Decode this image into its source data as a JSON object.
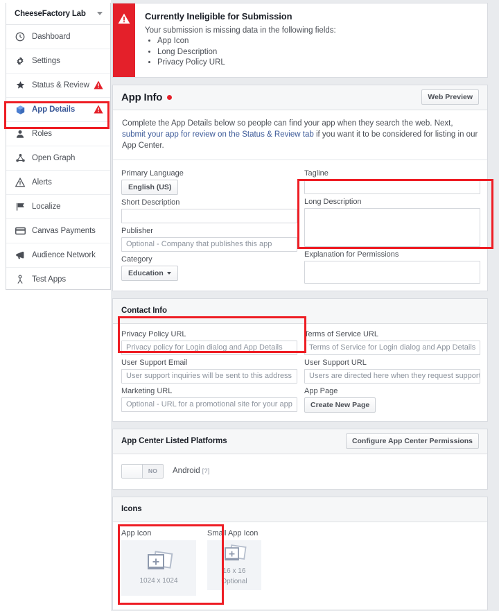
{
  "sidebar": {
    "header": {
      "title": "CheeseFactory Lab",
      "caret": "chevron-down-icon"
    },
    "items": [
      {
        "label": "Dashboard",
        "icon": "clock-icon",
        "warn": false,
        "active": false
      },
      {
        "label": "Settings",
        "icon": "gear-icon",
        "warn": false,
        "active": false
      },
      {
        "label": "Status & Review",
        "icon": "star-icon",
        "warn": true,
        "active": false
      },
      {
        "label": "App Details",
        "icon": "box-icon",
        "warn": true,
        "active": true
      },
      {
        "label": "Roles",
        "icon": "person-icon",
        "warn": false,
        "active": false
      },
      {
        "label": "Open Graph",
        "icon": "graph-icon",
        "warn": false,
        "active": false
      },
      {
        "label": "Alerts",
        "icon": "warning-icon",
        "warn": false,
        "active": false
      },
      {
        "label": "Localize",
        "icon": "flag-icon",
        "warn": false,
        "active": false
      },
      {
        "label": "Canvas Payments",
        "icon": "card-icon",
        "warn": false,
        "active": false
      },
      {
        "label": "Audience Network",
        "icon": "megaphone-icon",
        "warn": false,
        "active": false
      },
      {
        "label": "Test Apps",
        "icon": "people-icon",
        "warn": false,
        "active": false
      }
    ]
  },
  "alert": {
    "icon": "warning-triangle-icon",
    "title": "Currently Ineligible for Submission",
    "subtitle": "Your submission is missing data in the following fields:",
    "fields": [
      "App Icon",
      "Long Description",
      "Privacy Policy URL"
    ]
  },
  "app_info": {
    "title": "App Info",
    "status_dot": "red-status-dot",
    "web_preview_button": "Web Preview",
    "intro_part1": "Complete the App Details below so people can find your app when they search the web. Next, ",
    "intro_link": "submit your app for review on the Status & Review tab",
    "intro_part2": " if you want it to be considered for listing in our App Center.",
    "primary_language": {
      "label": "Primary Language",
      "value": "English (US)"
    },
    "tagline": {
      "label": "Tagline",
      "value": "",
      "placeholder": ""
    },
    "short_description": {
      "label": "Short Description",
      "value": "",
      "placeholder": ""
    },
    "long_description": {
      "label": "Long Description",
      "value": "",
      "placeholder": ""
    },
    "publisher": {
      "label": "Publisher",
      "value": "",
      "placeholder": "Optional - Company that publishes this app"
    },
    "category": {
      "label": "Category",
      "value": "Education"
    },
    "explanation_for_permissions": {
      "label": "Explanation for Permissions",
      "value": "",
      "placeholder": ""
    }
  },
  "contact_info": {
    "title": "Contact Info",
    "privacy_policy_url": {
      "label": "Privacy Policy URL",
      "value": "",
      "placeholder": "Privacy policy for Login dialog and App Details"
    },
    "terms_of_service_url": {
      "label": "Terms of Service URL",
      "value": "",
      "placeholder": "Terms of Service for Login dialog and App Details"
    },
    "user_support_email": {
      "label": "User Support Email",
      "value": "",
      "placeholder": "User support inquiries will be sent to this address"
    },
    "user_support_url": {
      "label": "User Support URL",
      "value": "",
      "placeholder": "Users are directed here when they request support"
    },
    "marketing_url": {
      "label": "Marketing URL",
      "value": "",
      "placeholder": "Optional - URL for a promotional site for your app"
    },
    "app_page": {
      "label": "App Page",
      "button": "Create New Page"
    }
  },
  "platforms": {
    "title": "App Center Listed Platforms",
    "configure_button": "Configure App Center Permissions",
    "android": {
      "toggle_state": "NO",
      "label": "Android",
      "help": "[?]"
    }
  },
  "icons": {
    "title": "Icons",
    "app_icon": {
      "label": "App Icon",
      "placeholder_icon": "add-photo-icon",
      "size": "1024 x 1024",
      "note": ""
    },
    "small_app_icon": {
      "label": "Small App Icon",
      "placeholder_icon": "add-photo-icon",
      "size": "16 x 16",
      "note": "Optional"
    }
  },
  "colors": {
    "alert_red": "#e4202a",
    "highlight_red": "#ee1d24",
    "link_blue": "#3b5998",
    "page_bg": "#e9ebee"
  }
}
